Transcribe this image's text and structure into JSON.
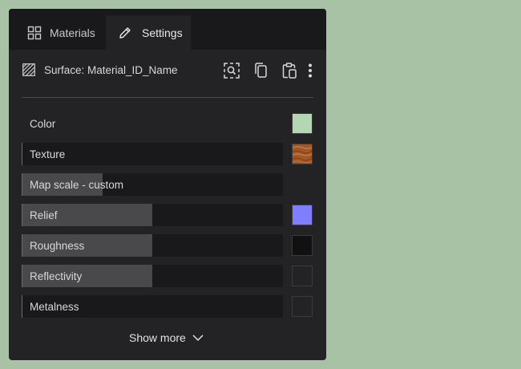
{
  "tabs": [
    {
      "label": "Materials",
      "icon": "grid-icon",
      "active": false
    },
    {
      "label": "Settings",
      "icon": "pencil-icon",
      "active": true
    }
  ],
  "surface": {
    "label": "Surface: Material_ID_Name",
    "icon": "hatch-icon",
    "tools": [
      "inspect-icon",
      "copy-icon",
      "paste-icon",
      "more-vertical-icon"
    ]
  },
  "properties": [
    {
      "label": "Color",
      "kind": "swatch",
      "swatch_color": "#b5d6b2"
    },
    {
      "label": "Texture",
      "kind": "slider",
      "level": 0,
      "swatch_color": "wood-texture"
    },
    {
      "label": "Map scale - custom",
      "kind": "slider",
      "level": 0.31
    },
    {
      "label": "Relief",
      "kind": "slider",
      "level": 0.5,
      "swatch_color": "#7f7ffe"
    },
    {
      "label": "Roughness",
      "kind": "slider",
      "level": 0.5,
      "swatch_color": "#111112"
    },
    {
      "label": "Reflectivity",
      "kind": "slider",
      "level": 0.5,
      "swatch_color": "#232325"
    },
    {
      "label": "Metalness",
      "kind": "slider",
      "level": 0,
      "swatch_color": "#232325"
    }
  ],
  "show_more": {
    "label": "Show more",
    "icon": "chevron-down-icon"
  },
  "colors": {
    "background": "#a8c2a6",
    "panel": "#232325",
    "tab_bar": "#19191b",
    "slider_track": "#19191b",
    "slider_fill": "#49494c",
    "text": "#d8d8da"
  }
}
